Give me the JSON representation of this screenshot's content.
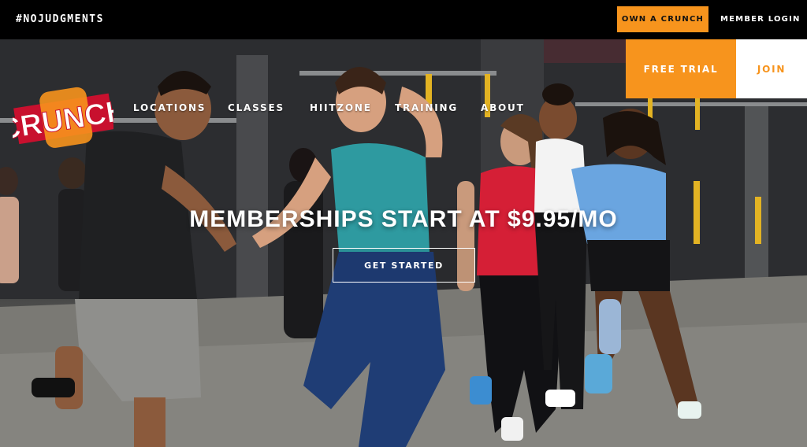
{
  "topbar": {
    "hashtag": "#NOJUDGMENTS",
    "own_label": "OWN A CRUNCH",
    "login_label": "MEMBER LOGIN"
  },
  "logo": {
    "text": "CRUNCH"
  },
  "nav": {
    "items": [
      "LOCATIONS",
      "CLASSES",
      "HIITZONE",
      "TRAINING",
      "ABOUT"
    ]
  },
  "cta_buttons": {
    "free_trial": "FREE TRIAL",
    "join": "JOIN"
  },
  "hero": {
    "headline": "MEMBERSHIPS START AT $9.95/MO",
    "button": "GET STARTED"
  },
  "colors": {
    "accent": "#f7941d",
    "logo_red": "#c8102e",
    "topbar": "#000000",
    "white": "#ffffff"
  }
}
